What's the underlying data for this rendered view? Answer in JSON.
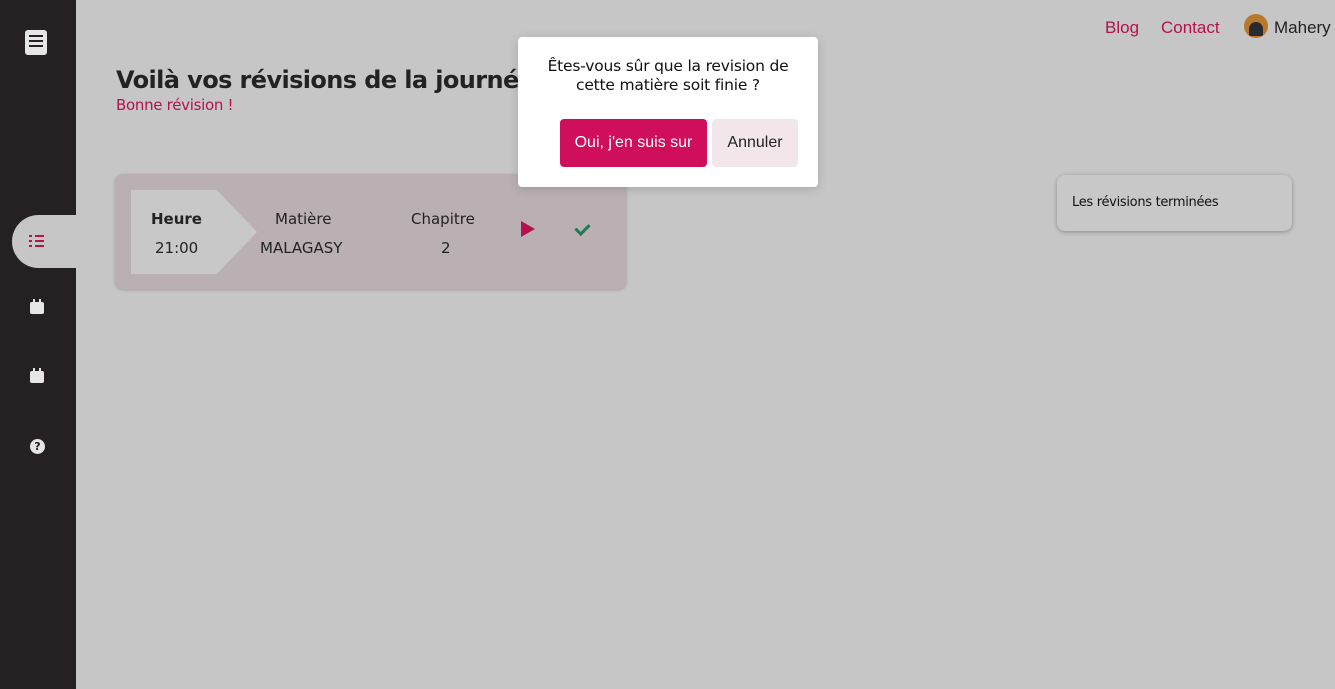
{
  "nav": {
    "blog": "Blog",
    "contact": "Contact",
    "username": "Mahery"
  },
  "sidebar": {
    "items": [
      {
        "icon": "book-logo-icon"
      },
      {
        "icon": "list-check-icon",
        "active": true
      },
      {
        "icon": "calendar-icon"
      },
      {
        "icon": "calendar-grid-icon"
      },
      {
        "icon": "help-circle-icon"
      }
    ]
  },
  "main": {
    "title": "Voilà vos révisions de la journée",
    "subtitle": "Bonne révision !"
  },
  "revision": {
    "time_header": "Heure",
    "time_value": "21:00",
    "subject_header": "Matière",
    "subject_value": "MALAGASY",
    "chapter_header": "Chapitre",
    "chapter_value": "2"
  },
  "finished_panel": {
    "label": "Les révisions terminées"
  },
  "modal": {
    "message": "Êtes-vous sûr que la revision de cette matière soit finie ?",
    "confirm_label": "Oui, j'en suis sur",
    "cancel_label": "Annuler"
  },
  "colors": {
    "accent": "#cf0f5b",
    "link": "#b3124e",
    "sidebar": "#252122",
    "check": "#1f7a55"
  }
}
